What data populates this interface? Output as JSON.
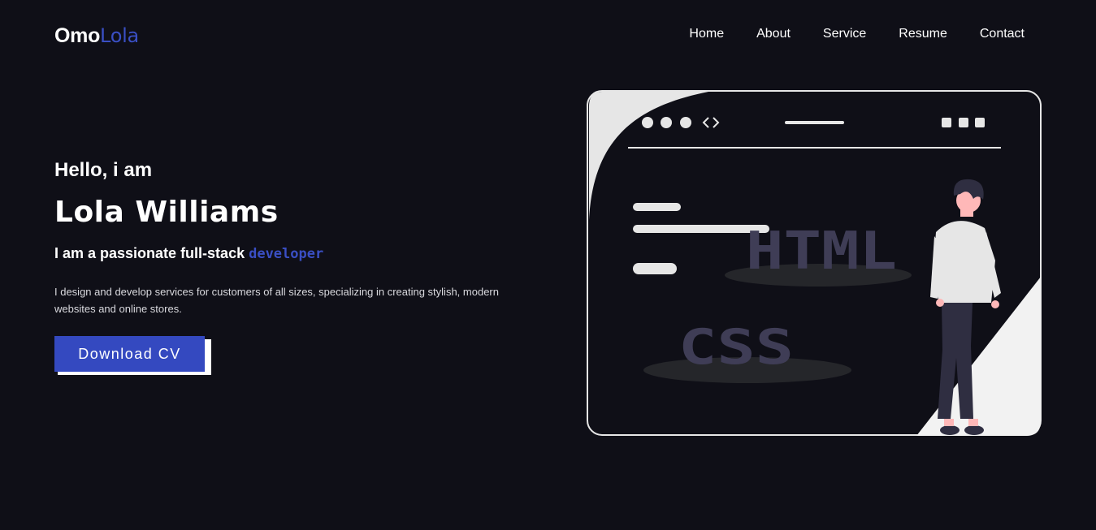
{
  "logo": {
    "part1": "Omo",
    "part2": "Lola"
  },
  "nav": {
    "home": "Home",
    "about": "About",
    "service": "Service",
    "resume": "Resume",
    "contact": "Contact"
  },
  "hero": {
    "greeting": "Hello, i am",
    "name": "Lola Williams",
    "tagline_prefix": "I am a passionate full-stack ",
    "tagline_accent": "developer",
    "description": "I design and develop services for customers of all sizes, specializing in creating stylish, modern websites and online stores.",
    "button_label": "Download CV"
  },
  "illustration": {
    "label_html": "HTML",
    "label_css": "CSS"
  },
  "colors": {
    "background": "#0f0f17",
    "accent": "#3a4fc4",
    "text": "#ffffff"
  }
}
